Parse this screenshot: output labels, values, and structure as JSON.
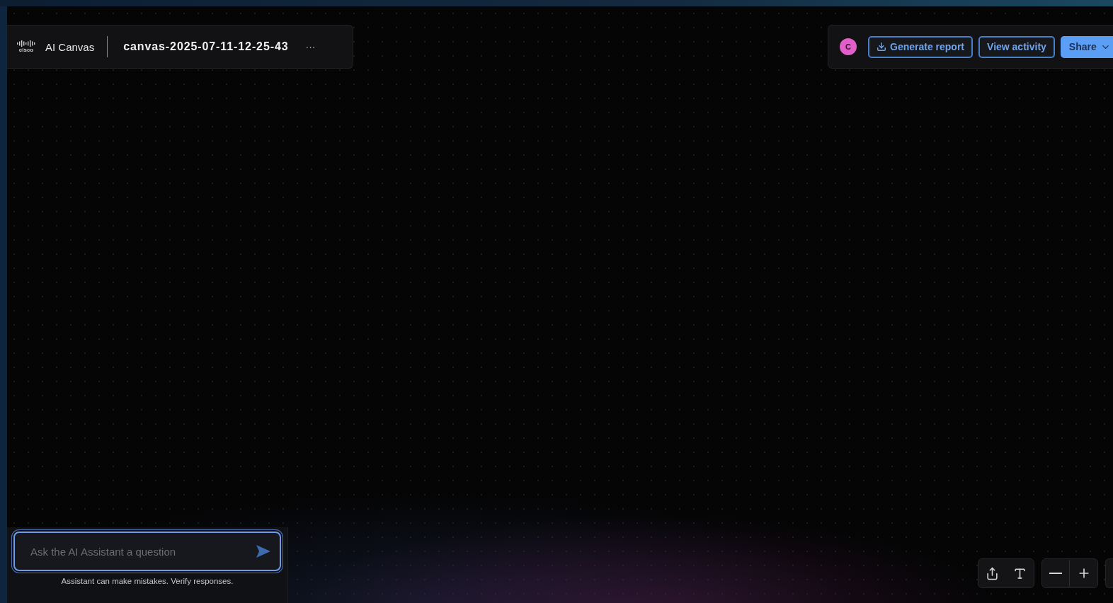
{
  "header": {
    "logo_text": "cisco",
    "app_name": "AI Canvas",
    "canvas_name": "canvas-2025-07-11-12-25-43",
    "more": "···"
  },
  "actions": {
    "avatar": "C",
    "buttons": [
      {
        "kind": "download",
        "label": "Generate report"
      },
      {
        "kind": "plain",
        "label": "View activity"
      },
      {
        "kind": "menu",
        "label": "Share"
      }
    ]
  },
  "chat": {
    "placeholder": "Ask the AI Assistant a question",
    "disclaimer": "Assistant can make mistakes. Verify responses."
  }
}
